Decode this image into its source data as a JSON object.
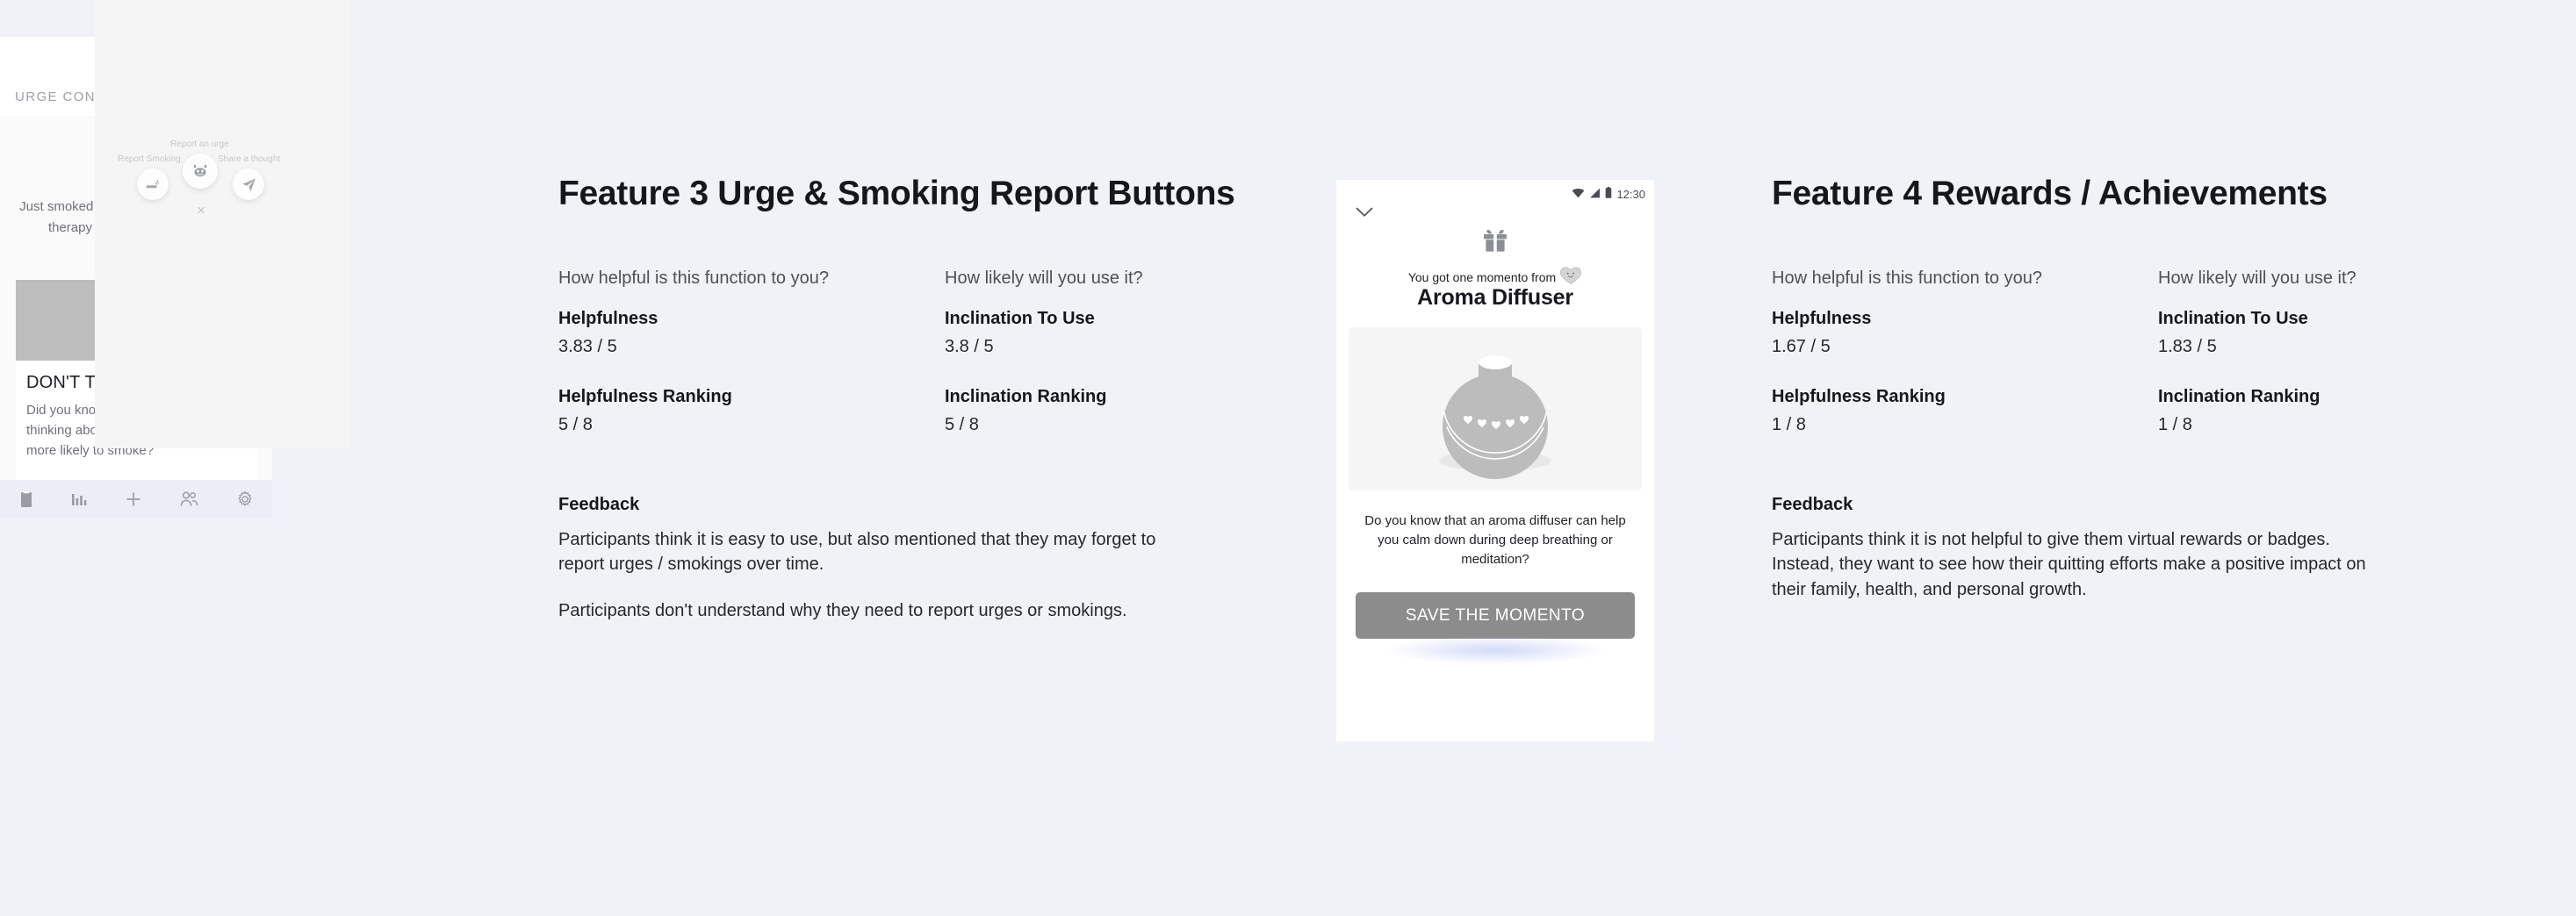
{
  "page": {
    "background": "#f1f2f7"
  },
  "features": [
    {
      "title": "Feature 3 Urge & Smoking Report Buttons",
      "helpfulness_question": "How helpful is this function to you?",
      "helpfulness_label": "Helpfulness",
      "helpfulness_value": "3.83 / 5",
      "helpfulness_ranking_label": "Helpfulness Ranking",
      "helpfulness_ranking_value": "5 / 8",
      "inclination_question": "How likely will you use it?",
      "inclination_label": "Inclination To Use",
      "inclination_value": "3.8 / 5",
      "inclination_ranking_label": "Inclination Ranking",
      "inclination_ranking_value": "5 / 8",
      "feedback_label": "Feedback",
      "feedback_1": "Participants think it is easy to use, but also mentioned that they may forget to report urges / smokings over time.",
      "feedback_2": "Participants don't understand why they need to report urges or smokings."
    },
    {
      "title": "Feature 4 Rewards / Achievements",
      "helpfulness_question": "How helpful is this function to you?",
      "helpfulness_label": "Helpfulness",
      "helpfulness_value": "1.67 / 5",
      "helpfulness_ranking_label": "Helpfulness Ranking",
      "helpfulness_ranking_value": "1 / 8",
      "inclination_question": "How likely will you use it?",
      "inclination_label": "Inclination To Use",
      "inclination_value": "1.83 / 5",
      "inclination_ranking_label": "Inclination Ranking",
      "inclination_ranking_value": "1 / 8",
      "feedback_label": "Feedback",
      "feedback_1": "Participants think it is not helpful to give them virtual rewards or badges. Instead, they want to see how their quitting efforts make a positive impact on their family, health, and personal growth.",
      "feedback_2": ""
    }
  ],
  "mockup_left": {
    "screen_title": "URGE CONTROL",
    "quote": "Just smoked and feel guilty? Take some therapy and you will be better!",
    "card_title": "DON'T THINK ABOUT IT",
    "card_body": "Did you know that people who avoid thinking about smoking are actually more likely to smoke?",
    "overlay": {
      "report_smoking_label": "Report Smoking",
      "report_urge_label": "Report an urge",
      "share_thought_label": "Share a thought",
      "close_label": "×"
    },
    "tabbar": [
      {
        "name": "journal-icon"
      },
      {
        "name": "stats-icon"
      },
      {
        "name": "add-icon"
      },
      {
        "name": "community-icon"
      },
      {
        "name": "settings-icon"
      }
    ]
  },
  "phone": {
    "status_time": "12:30",
    "momento_line": "You got one momento from",
    "award_name": "Aroma Diffuser",
    "tip": "Do you know that an aroma diffuser can help you calm down during deep breathing or meditation?",
    "save_button": "SAVE THE MOMENTO"
  }
}
